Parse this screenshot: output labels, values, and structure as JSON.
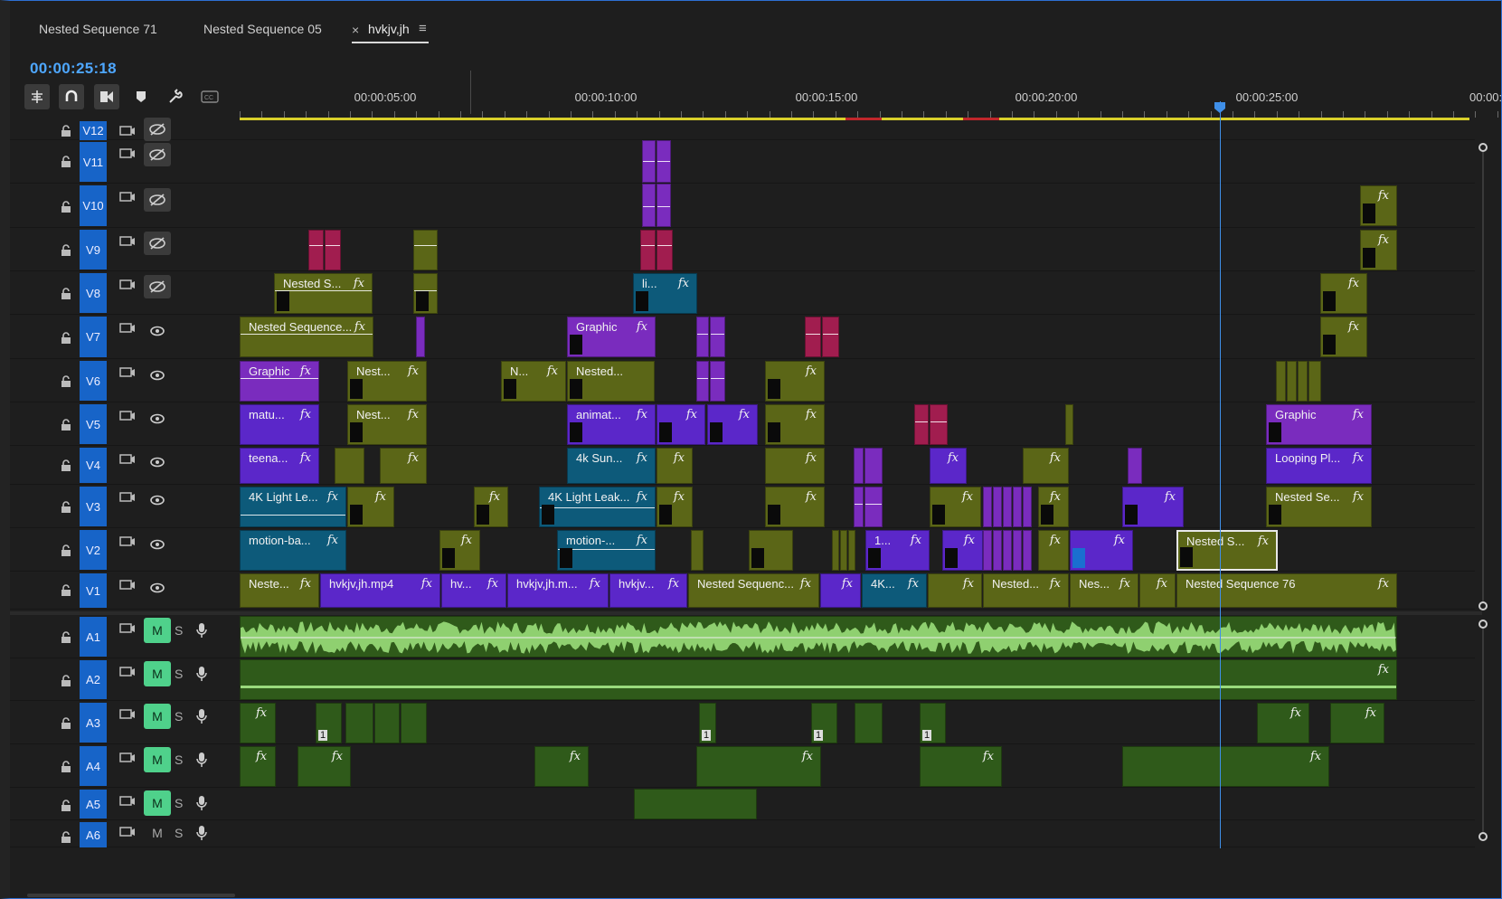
{
  "tabs": [
    {
      "label": "Nested Sequence 71"
    },
    {
      "label": "Nested Sequence 05"
    },
    {
      "label": "hvkjv,jh",
      "active": true
    }
  ],
  "timecode": "00:00:25:18",
  "tools": [
    "snap-insert-icon",
    "magnet-icon",
    "linked-selection-icon",
    "marker-icon",
    "wrench-icon",
    "captions-icon"
  ],
  "ruler": {
    "labels": [
      "00:00:05:00",
      "00:00:10:00",
      "00:00:15:00",
      "00:00:20:00",
      "00:00:25:00",
      "00:00:"
    ]
  },
  "video_tracks": [
    {
      "name": "V12",
      "visibility": "hidden"
    },
    {
      "name": "V11",
      "visibility": "hidden"
    },
    {
      "name": "V10",
      "visibility": "hidden"
    },
    {
      "name": "V9",
      "visibility": "hidden"
    },
    {
      "name": "V8",
      "visibility": "hidden"
    },
    {
      "name": "V7",
      "visibility": "visible"
    },
    {
      "name": "V6",
      "visibility": "visible"
    },
    {
      "name": "V5",
      "visibility": "visible"
    },
    {
      "name": "V4",
      "visibility": "visible"
    },
    {
      "name": "V3",
      "visibility": "visible"
    },
    {
      "name": "V2",
      "visibility": "visible"
    },
    {
      "name": "V1",
      "visibility": "visible"
    }
  ],
  "audio_tracks": [
    {
      "name": "A1",
      "mute": "M",
      "solo": "S",
      "muted": true
    },
    {
      "name": "A2",
      "mute": "M",
      "solo": "S",
      "muted": true
    },
    {
      "name": "A3",
      "mute": "M",
      "solo": "S",
      "muted": true
    },
    {
      "name": "A4",
      "mute": "M",
      "solo": "S",
      "muted": true
    },
    {
      "name": "A5",
      "mute": "M",
      "solo": "S",
      "muted": true
    },
    {
      "name": "A6",
      "mute": "M",
      "solo": "S",
      "muted": false
    }
  ],
  "clips": {
    "V8": [
      "Nested S...",
      "li..."
    ],
    "V7": [
      "Nested Sequence...",
      "Graphic"
    ],
    "V6": [
      "Graphic",
      "Nest...",
      "N...",
      "Nested..."
    ],
    "V5": [
      "matu...",
      "Nest...",
      "animat...",
      "Graphic"
    ],
    "V4": [
      "teena...",
      "4k Sun...",
      "Looping Pl..."
    ],
    "V3": [
      "4K Light Le...",
      "4K Light Leak...",
      "Nested Se..."
    ],
    "V2": [
      "motion-ba...",
      "motion-...",
      "1...",
      "Nested S..."
    ],
    "V1": [
      "Neste...",
      "hvkjv,jh.mp4",
      "hv...",
      "hvkjv,jh.m...",
      "hvkjv...",
      "Nested Sequenc...",
      "4K...",
      "Nested...",
      "Nes...",
      "Nested Sequence 76"
    ]
  },
  "fx_label": "fx",
  "clip_badge": "1",
  "colors": {
    "accent": "#4ea7ff",
    "olive": "#5b6617",
    "purple": "#7a2cbe",
    "violet": "#5b27c9",
    "teal": "#0d5a7a",
    "magenta": "#a11d4f",
    "audio": "#2f5a1a",
    "mute_on": "#4fd18b"
  }
}
